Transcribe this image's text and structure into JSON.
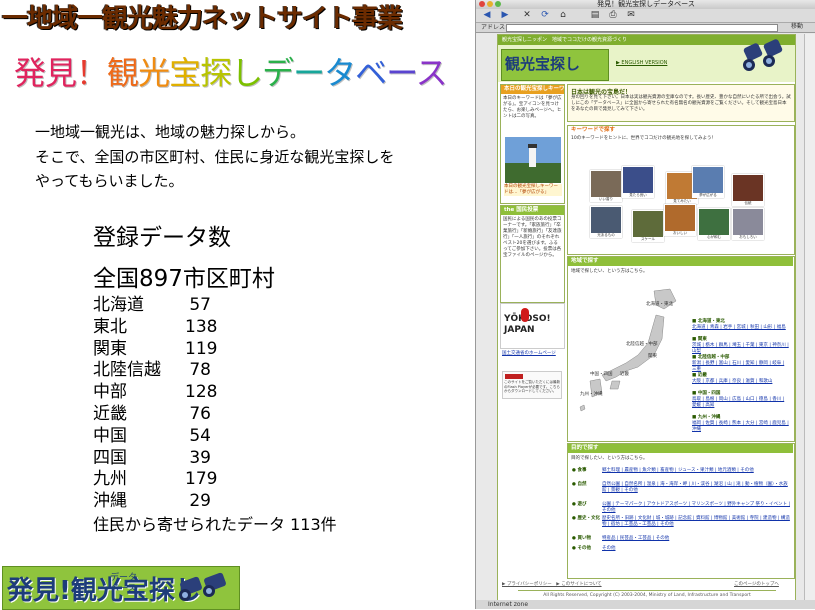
{
  "slide": {
    "title": "一地域一観光魅力ネットサイト事業",
    "subtitle_chars": [
      {
        "ch": "発",
        "color": "#e0245e"
      },
      {
        "ch": "見",
        "color": "#e0245e"
      },
      {
        "ch": "！",
        "color": "#e63a2e"
      },
      {
        "ch": "観",
        "color": "#ee6a1a"
      },
      {
        "ch": "光",
        "color": "#f08c12"
      },
      {
        "ch": "宝",
        "color": "#e0b000"
      },
      {
        "ch": "探",
        "color": "#b8c400"
      },
      {
        "ch": "し",
        "color": "#7cc000"
      },
      {
        "ch": "デ",
        "color": "#2ab04a"
      },
      {
        "ch": "ー",
        "color": "#17a69a"
      },
      {
        "ch": "タ",
        "color": "#1a8ad0"
      },
      {
        "ch": "ベ",
        "color": "#3360d8"
      },
      {
        "ch": "ー",
        "color": "#5a44d0"
      },
      {
        "ch": "ス",
        "color": "#8a34c8"
      }
    ],
    "intro_lines": [
      "一地域一観光は、地域の魅力探しから。",
      "そこで、全国の市区町村、住民に身近な観光宝探しを",
      "やってもらいました。"
    ],
    "count_heading": "登録データ数",
    "count_total": "全国897市区町村",
    "regions": [
      {
        "name": "北海道",
        "value": "57"
      },
      {
        "name": "東北",
        "value": "138"
      },
      {
        "name": "関東",
        "value": "119"
      },
      {
        "name": "北陸信越",
        "value": "78"
      },
      {
        "name": "中部",
        "value": "128"
      },
      {
        "name": "近畿",
        "value": "76"
      },
      {
        "name": "中国",
        "value": "54"
      },
      {
        "name": "四国",
        "value": "39"
      },
      {
        "name": "九州",
        "value": "179"
      },
      {
        "name": "沖縄",
        "value": "29"
      }
    ],
    "resident_line": "住民から寄せられたデータ 113件",
    "banner": {
      "kanji": "発見!観光宝探し",
      "kana_1": "データ",
      "kana_2": "ベース"
    }
  },
  "browser": {
    "window_title": "発見！観光宝探しデータベース",
    "address_label": "アドレス",
    "address_value": "",
    "go_label": "移動",
    "status": "Internet zone",
    "toolbar_icons": [
      "back-icon",
      "forward-icon",
      "stop-icon",
      "refresh-icon",
      "home-icon",
      "autofill-icon",
      "print-icon",
      "mail-icon"
    ],
    "page": {
      "tagline": "観光宝探しニッポン　地域でココだけの観光資源づくり",
      "logo_text": "観光宝探し",
      "english_link": "▶ ENGLISH VERSION",
      "today_keyword": {
        "heading": "本日の観光宝探しキーワード",
        "text": "本日のキーワードは「夢が広がる」。宝アイコンを見つけたら、お楽しみページへ。ヒントは二の写真。",
        "caption": "本日の観光宝探しキーワードは…「夢が広がる」"
      },
      "vote": {
        "heading": "the 国民投票",
        "text": "国民による国民のあの投票コーナーです。「家族旅行」「卒業旅行」「新婚旅行」「友達旅行」「一人旅行」のそれぞれベスト20を選びます。ふるってご参加下さい。投票は各宝ファイルのページから。"
      },
      "yokoso": "YŌKOSO! JAPAN",
      "mlit_link": "国土交通省のホームページ",
      "flash_note": "このサイトをご覧いただくには最新のFlash Playerが必要です。こちらからダウンロードしてください。",
      "about": {
        "heading": "日本は観光の宝島だ！",
        "text": "身の回りを見て下さい。日本は実は観光資源の宝庫なのです。長い歴史、豊かな自然にいたる所で出会う。試しにこの「データベース」に全国から寄せられた有名無名の観光資源をご覧ください。そして観光宝島日本をあなたの目で発見してみて下さい。"
      },
      "keyword_search": {
        "heading": "キーワードで探す",
        "text": "10のキーワードをヒントに、世界でココだけの観光地を探してみよう！",
        "photos": [
          {
            "label": "いい香り",
            "color": "#7a6a58"
          },
          {
            "label": "見たら良い",
            "color": "#3b4e8a"
          },
          {
            "label": "見てみたい",
            "color": "#c07a34"
          },
          {
            "label": "夢が広がる",
            "color": "#5a7db0"
          },
          {
            "label": "伝統",
            "color": "#6a3424"
          },
          {
            "label": "光あるもの",
            "color": "#4a5a72"
          },
          {
            "label": "スケール",
            "color": "#5e6b3a"
          },
          {
            "label": "おいしい",
            "color": "#b06a2c"
          },
          {
            "label": "心が和む",
            "color": "#3e7040"
          },
          {
            "label": "おもしろい",
            "color": "#8a8a9a"
          }
        ]
      },
      "region_search": {
        "heading": "地域で探す",
        "text": "地域で探したい、という方はこちら。",
        "map_labels": [
          "北海道・東北",
          "北陸信越・中部",
          "関東",
          "中国・四国",
          "近畿",
          "九州・沖縄"
        ],
        "lists": [
          {
            "group": "北海道・東北",
            "items": "北海道 | 青森 | 岩手 | 宮城 | 秋田 | 山形 | 福島"
          },
          {
            "group": "関東",
            "items": "茨城 | 栃木 | 群馬 | 埼玉 | 千葉 | 東京 | 神奈川 | 山梨"
          },
          {
            "group": "北陸信越・中部",
            "items": "新潟 | 長野 | 富山 | 石川 | 愛知 | 静岡 | 岐阜 | 三重"
          },
          {
            "group": "近畿",
            "items": "大阪 | 京都 | 兵庫 | 奈良 | 滋賀 | 和歌山"
          },
          {
            "group": "中国・四国",
            "items": "鳥取 | 島根 | 岡山 | 広島 | 山口 | 徳島 | 香川 | 愛媛 | 高知"
          },
          {
            "group": "九州・沖縄",
            "items": "福岡 | 佐賀 | 長崎 | 熊本 | 大分 | 宮崎 | 鹿児島 | 沖縄"
          }
        ]
      },
      "purpose_search": {
        "heading": "目的で探す",
        "text": "目的で探したい、という方はこちら。",
        "rows": [
          {
            "cat": "食事",
            "items": "郷土料理 | 農産物 | 魚介類 | 畜産物 | ジュース・果汁類 | 地元酒類 | その他"
          },
          {
            "cat": "自然",
            "items": "自然公園 | 自然名所 | 温泉 | 海・海岸・岬 | 川・渓谷 | 湖沼 | 山 | 滝 | 動・植物（園）・水族館 | 景観 | その他"
          },
          {
            "cat": "遊び",
            "items": "公園 | テーマパーク | アウトドアスポーツ | マリンスポーツ | 野外キャンプ 祭り・イベント | その他"
          },
          {
            "cat": "歴史・文化",
            "items": "歴史名所・旧跡 | 文化財 | 城・城跡 | 記念館 | 資料館 | 博物館 | 美術館 | 寺院 | 建造物 | 構造物 | 宿坊 | 工芸品・工芸品 | その他"
          },
          {
            "cat": "買い物",
            "items": "特産品 | 民芸品・工芸品 | その他"
          },
          {
            "cat": "その他",
            "items": "その他"
          }
        ]
      },
      "footer_left": "▶ プライバシーポリシー　▶ このサイトについて",
      "footer_right": "このページのトップへ",
      "copyright": "All Rights Reserved, Copyright (C) 2003-2004, Ministry of Land, Infrastructure and Transport"
    }
  }
}
